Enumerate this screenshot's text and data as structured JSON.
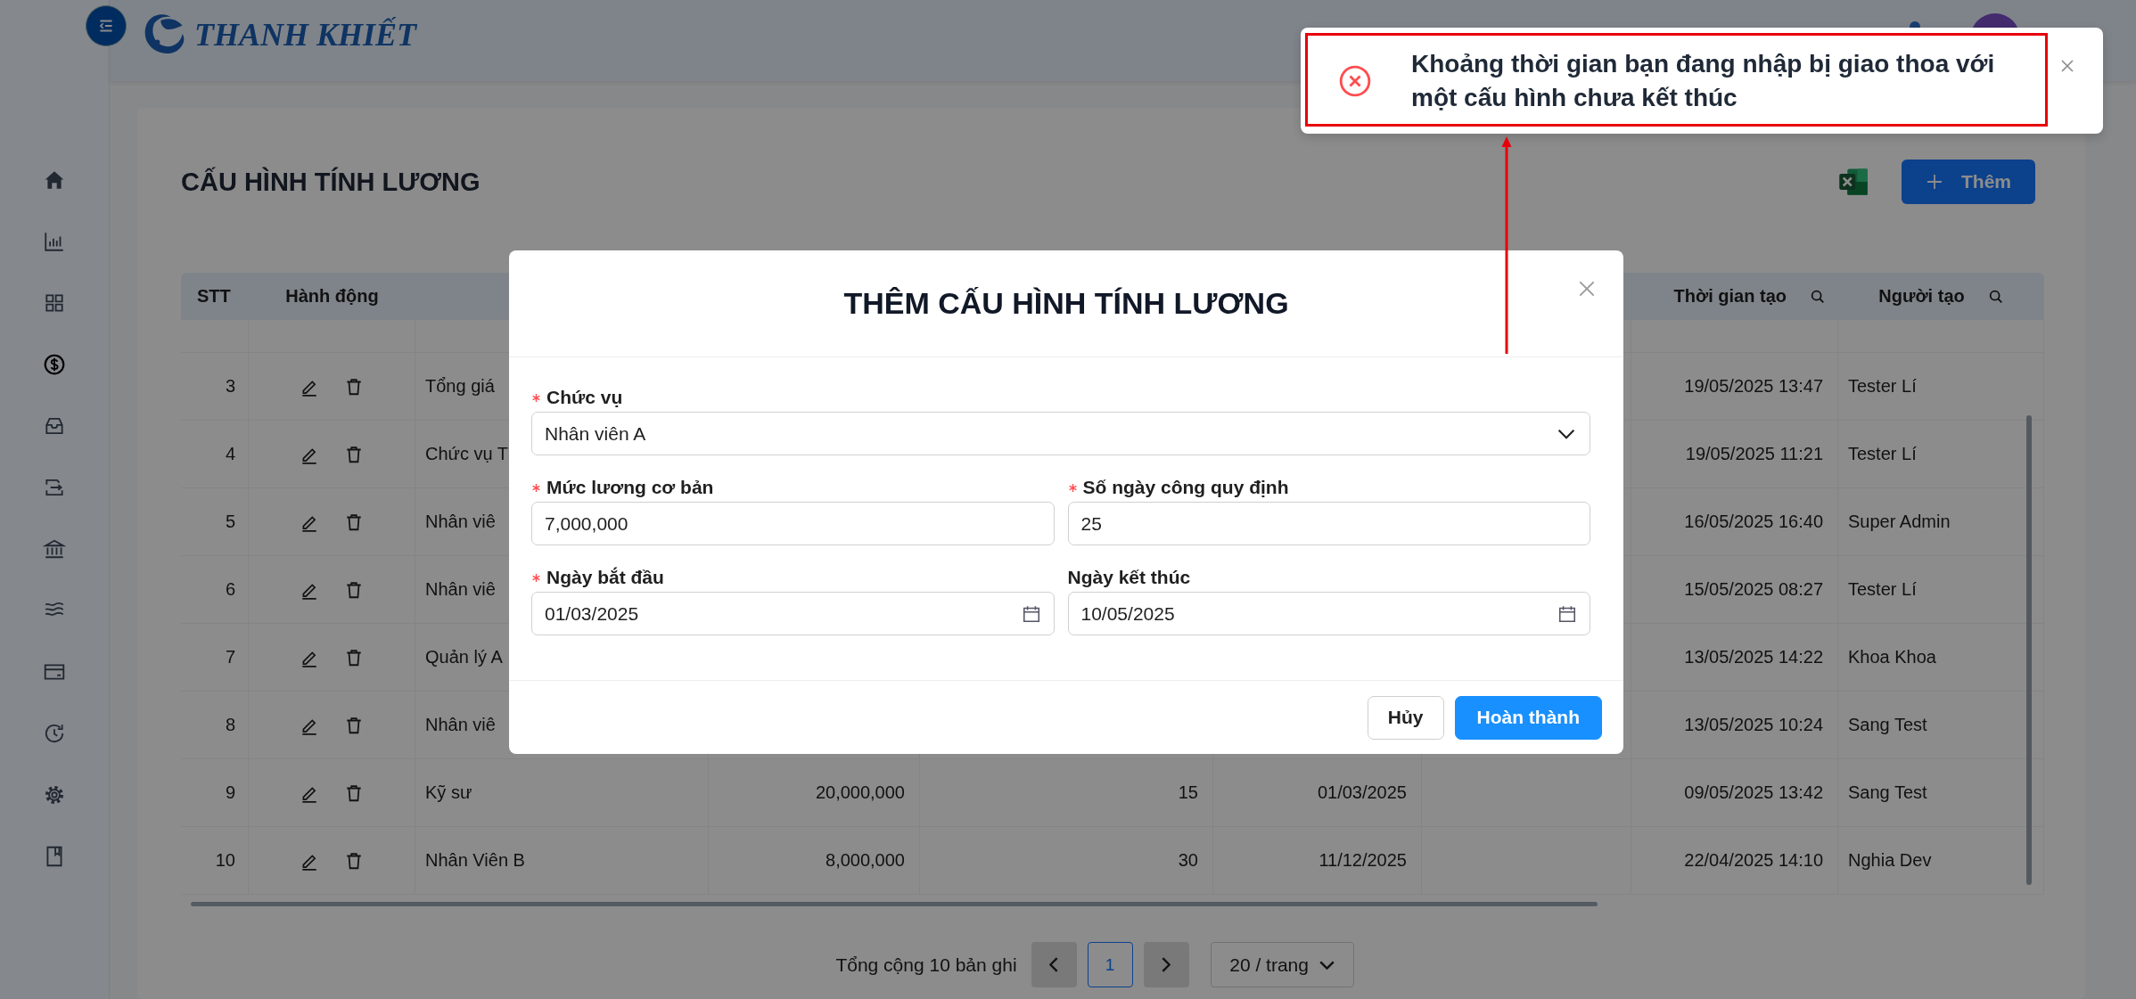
{
  "header": {
    "logo_text": "THANH KHIẾT"
  },
  "sidebar": {
    "items": [
      {
        "selected": false
      },
      {
        "selected": false
      },
      {
        "selected": false
      },
      {
        "selected": true
      },
      {
        "selected": false
      },
      {
        "selected": false
      },
      {
        "selected": false
      },
      {
        "selected": false
      },
      {
        "selected": false
      },
      {
        "selected": false
      },
      {
        "selected": false
      },
      {
        "selected": false
      }
    ]
  },
  "page": {
    "title": "CẤU HÌNH TÍNH LƯƠNG",
    "add_button": "Thêm"
  },
  "table": {
    "header": {
      "stt": "STT",
      "actions": "Hành động",
      "created_at": "Thời gian tạo",
      "created_by": "Người tạo"
    },
    "rows": [
      {
        "stt": "3",
        "name": "Tổng giá",
        "created_at": "19/05/2025 13:47",
        "created_by": "Tester Lí"
      },
      {
        "stt": "4",
        "name": "Chức vụ T",
        "created_at": "19/05/2025 11:21",
        "created_by": "Tester Lí"
      },
      {
        "stt": "5",
        "name": "Nhân viê",
        "created_at": "16/05/2025 16:40",
        "created_by": "Super Admin"
      },
      {
        "stt": "6",
        "name": "Nhân viê",
        "created_at": "15/05/2025 08:27",
        "created_by": "Tester Lí"
      },
      {
        "stt": "7",
        "name": "Quản lý A",
        "created_at": "13/05/2025 14:22",
        "created_by": "Khoa Khoa"
      },
      {
        "stt": "8",
        "name": "Nhân viê",
        "created_at": "13/05/2025 10:24",
        "created_by": "Sang Test"
      },
      {
        "stt": "9",
        "name": "Kỹ sư",
        "salary": "20,000,000",
        "days": "15",
        "start_date": "01/03/2025",
        "created_at": "09/05/2025 13:42",
        "created_by": "Sang Test"
      },
      {
        "stt": "10",
        "name": "Nhân Viên B",
        "salary": "8,000,000",
        "days": "30",
        "start_date": "11/12/2025",
        "created_at": "22/04/2025 14:10",
        "created_by": "Nghia Dev"
      }
    ]
  },
  "pagination": {
    "total": "Tổng cộng 10 bản ghi",
    "pages": [
      {
        "label": "1",
        "selected": true
      }
    ],
    "page_size": "20 / trang"
  },
  "modal": {
    "title": "THÊM CẤU HÌNH TÍNH LƯƠNG",
    "fields": [
      {
        "kind": "select",
        "label": "Chức vụ",
        "required": true,
        "value": "Nhân viên A"
      },
      {
        "kind": "text",
        "label": "Mức lương cơ bản",
        "required": true,
        "value": "7,000,000"
      },
      {
        "kind": "text",
        "label": "Số ngày công quy định",
        "required": true,
        "value": "25"
      },
      {
        "kind": "date",
        "label": "Ngày bắt đầu",
        "required": true,
        "value": "01/03/2025"
      },
      {
        "kind": "date",
        "label": "Ngày kết thúc",
        "required": false,
        "value": "10/05/2025"
      }
    ],
    "buttons": [
      {
        "kind": "default",
        "label": "Hủy"
      },
      {
        "kind": "primary",
        "label": "Hoàn thành"
      }
    ]
  },
  "toast": {
    "kind": "error",
    "message": "Khoảng thời gian bạn đang nhập bị giao thoa với một cấu hình chưa kết thúc"
  }
}
